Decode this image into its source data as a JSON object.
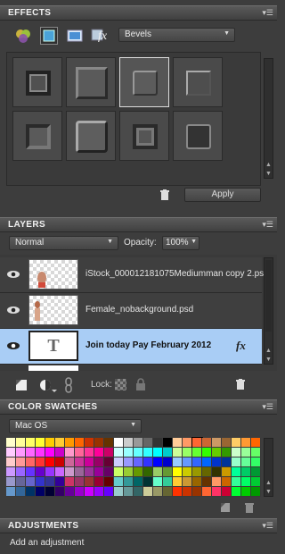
{
  "effects": {
    "title": "EFFECTS",
    "category": "Bevels",
    "apply_label": "Apply",
    "tile_count": 8,
    "selected_index": 2
  },
  "layers": {
    "title": "LAYERS",
    "blend_mode": "Normal",
    "opacity_label": "Opacity:",
    "opacity_value": "100%",
    "lock_label": "Lock:",
    "items": [
      {
        "name": "iStock_000012181075Mediumman copy 2.psd",
        "active": false
      },
      {
        "name": "Female_nobackground.psd",
        "active": false
      },
      {
        "name": "Join today  Pay February 2012",
        "active": true,
        "thumb_glyph": "T",
        "fx": "fx"
      }
    ]
  },
  "color_swatches": {
    "title": "COLOR SWATCHES",
    "library": "Mac OS"
  },
  "adjustments": {
    "title": "ADJUSTMENTS",
    "hint": "Add an adjustment"
  },
  "icons": [
    "menu-icon",
    "effects-icon",
    "layer-style-icon",
    "photo-effect-icon",
    "fx-icon",
    "trash-icon",
    "eye-icon",
    "new-layer-icon",
    "adjustment-layer-icon",
    "link-icon",
    "lock-transparency-icon",
    "lock-icon",
    "new-swatch-icon"
  ]
}
